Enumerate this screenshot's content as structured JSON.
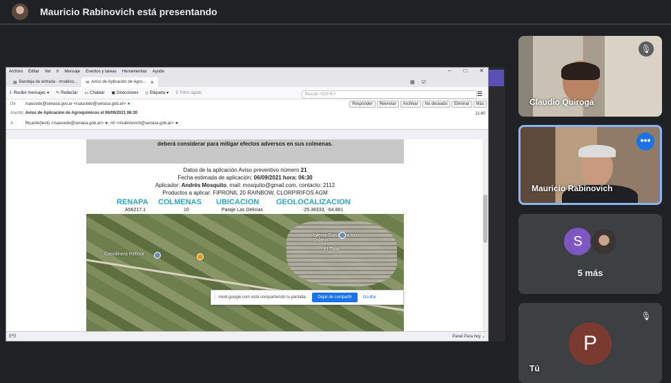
{
  "top": {
    "presenter_title": "Mauricio Rabinovich está presentando"
  },
  "shared": {
    "menu": [
      "Archivo",
      "Editar",
      "Ver",
      "Ir",
      "Mensaje",
      "Eventos y tareas",
      "Herramientas",
      "Ayuda"
    ],
    "window_controls": [
      "–",
      "□",
      "✕"
    ],
    "tabs": [
      {
        "label": "Bandeja de entrada - mrabino..."
      },
      {
        "label": "Aviso de Aplicación de Agro..."
      }
    ],
    "toolbar": {
      "receive": "Recibir mensajes",
      "compose": "Redactar",
      "chat": "Chatear",
      "address_book": "Direcciones",
      "tag": "Etiqueta",
      "quick_filter": "Filtro rápido",
      "search_placeholder": "Buscar <Ctrl+K>"
    },
    "header": {
      "from_label": "De",
      "from_value": "rsaucedo@senasa.gov.ar <rsaucedo@senasa.gob.ar>",
      "subject_label": "Asunto",
      "subject_value": "Aviso de Aplicación de Agroquímicos el 06/09/2021 06:30",
      "to_label": "A",
      "to_value": "Ricardo(testi) <rsaucedo@senasa.gob.ar> ★, ml <mrabinovich@senasa.gob.ar> ★",
      "time": "11:40",
      "actions": [
        "Responder",
        "Reenviar",
        "Archivar",
        "No deseado",
        "Eliminar",
        "Más"
      ]
    },
    "body": {
      "gray_text": "deberá considerar para mitigar efectos adversos en sus colmenas.",
      "line1_prefix": "Datos de la aplicación Aviso preventivo número ",
      "line1_number": "21",
      "line2_prefix": "Fecha estimada de aplicación: ",
      "line2_value": "06/09/2021 hora: 06:30",
      "line3_prefix": "Aplicador: ",
      "line3_name": "Andrés Mosquito",
      "line3_rest": ", mail: mosquito@gmail.com, contacto: 2112",
      "line4": "Productos a aplicar: FIPRONIL 20 RAINBOW, CLORPIRIFOS AGM",
      "cols": [
        "RENAPA",
        "COLMENAS",
        "UBICACION",
        "GEOLOCALIZACION"
      ],
      "vals": [
        "A56217.1",
        "10",
        "Paraje Las Delicias",
        "-25.38333, -64.881"
      ],
      "map_labels": {
        "gas": "Gasolinera Refinor",
        "church": "Iglesia San Francisco Solano",
        "town": "El Tipal"
      }
    },
    "sharebar": {
      "text": "meet.google.com está compartiendo tu pantalla.",
      "stop": "Dejar de compartir",
      "hide": "Ocultar"
    },
    "status": {
      "left": "((•))",
      "right": "Panel Para hoy ⌄"
    }
  },
  "participants": [
    {
      "name": "Claudio Quiroga"
    },
    {
      "name": "Mauricio Rabinovich"
    },
    {
      "avatar_letter": "S",
      "more_label": "5 más"
    },
    {
      "name": "Tú",
      "avatar_letter": "P"
    }
  ],
  "colors": {
    "bg": "#202124",
    "accent": "#1a73e8",
    "heading_teal": "#2aa7c4"
  }
}
